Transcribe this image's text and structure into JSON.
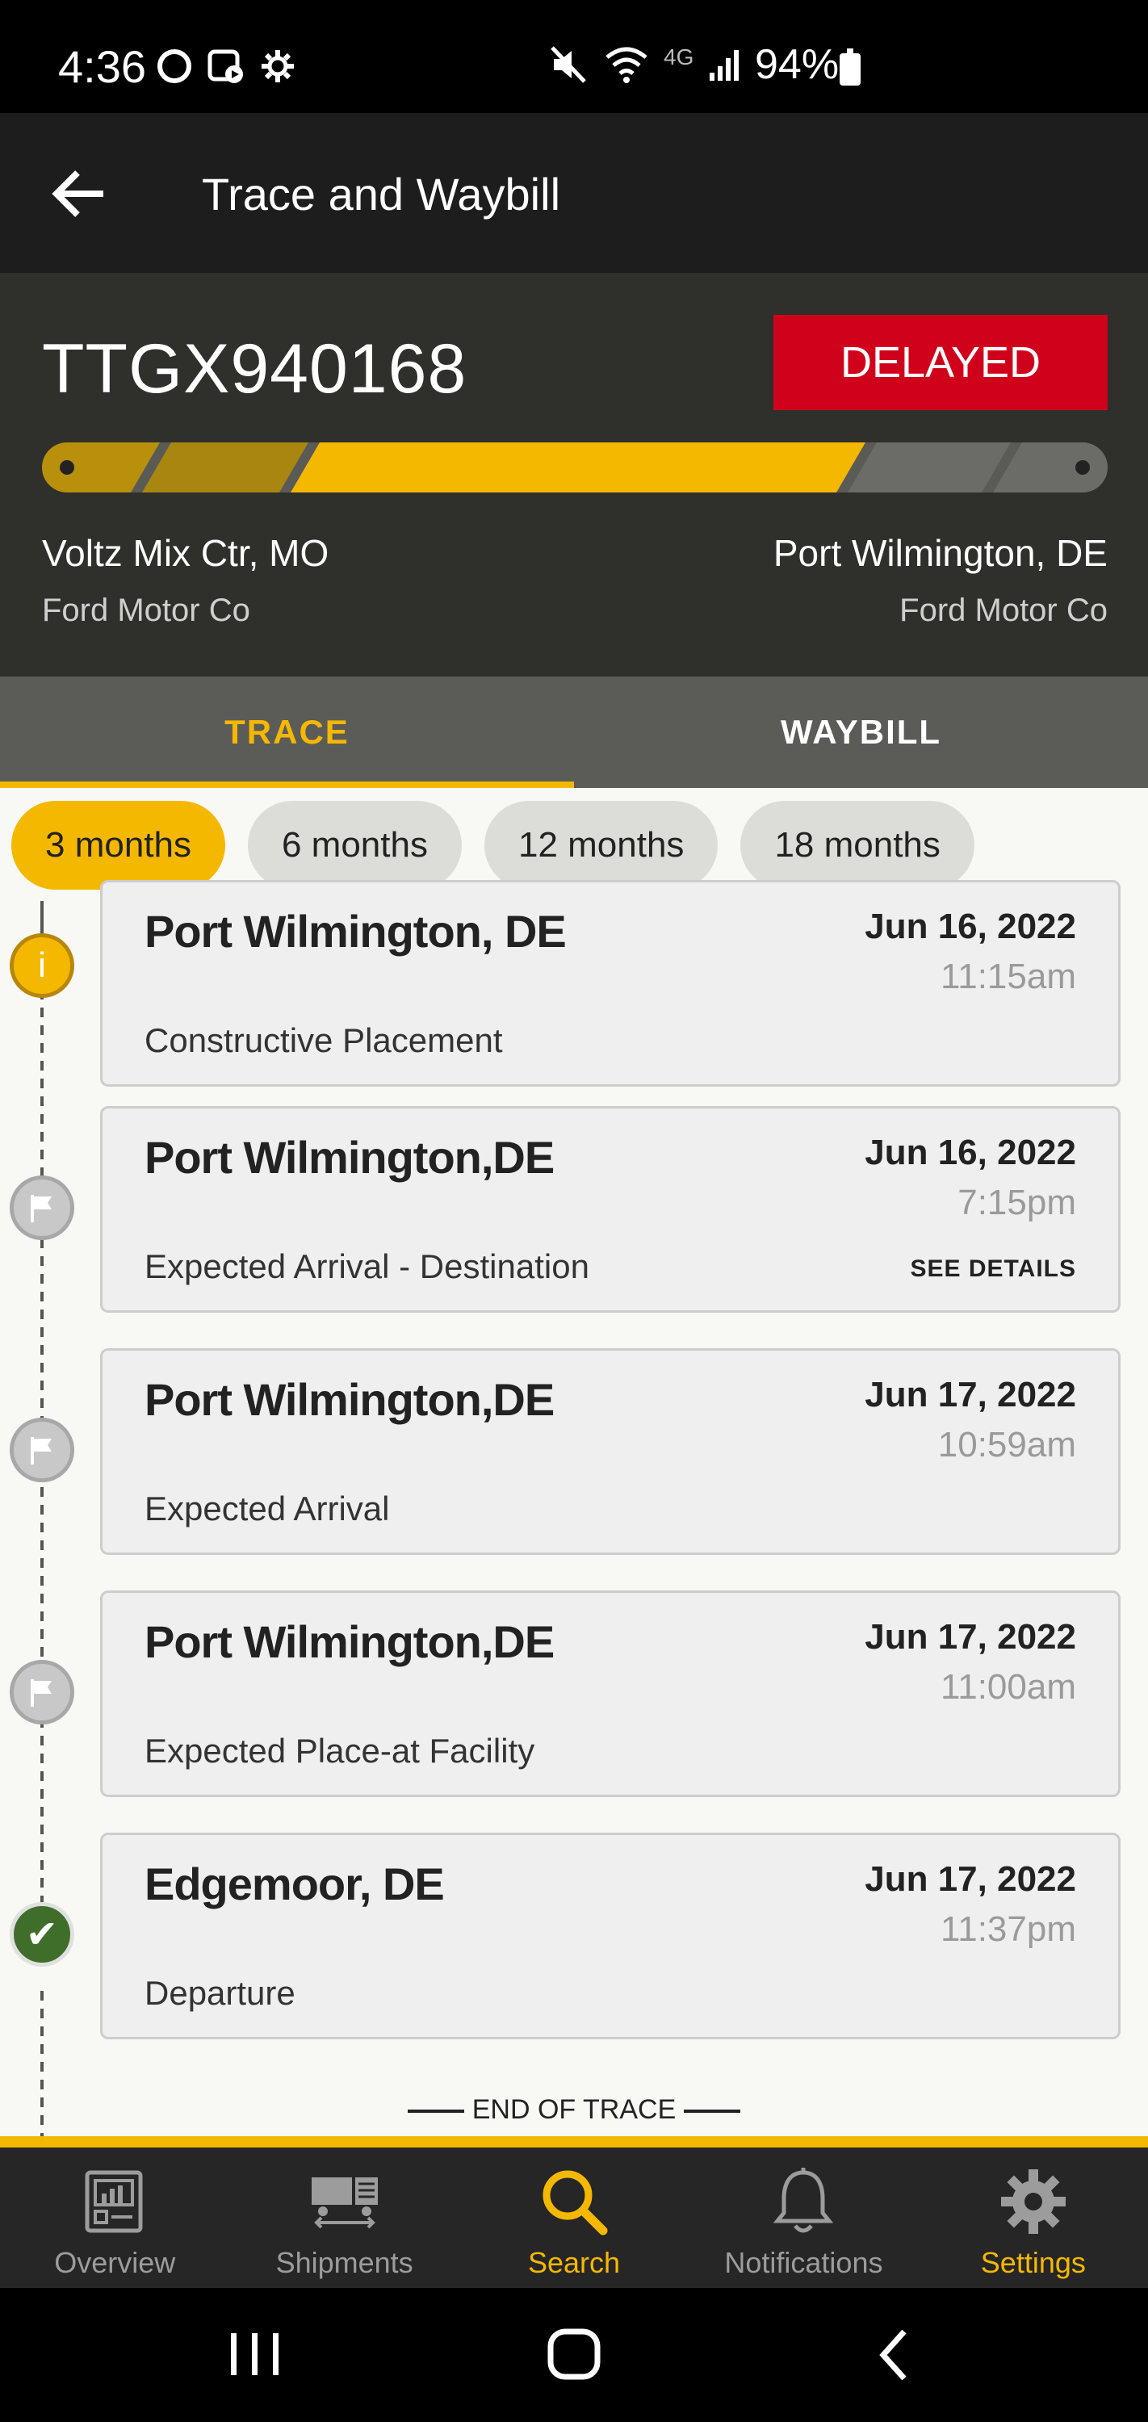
{
  "status_bar": {
    "time": "4:36",
    "network": "4G",
    "battery": "94%"
  },
  "header": {
    "title": "Trace and Waybill"
  },
  "shipment": {
    "car_id": "TTGX940168",
    "status": "DELAYED",
    "origin_city": "Voltz Mix Ctr, MO",
    "origin_company": "Ford Motor Co",
    "destination_city": "Port Wilmington, DE",
    "destination_company": "Ford Motor Co"
  },
  "tabs": [
    {
      "label": "TRACE",
      "active": true
    },
    {
      "label": "WAYBILL",
      "active": false
    }
  ],
  "filters": [
    {
      "label": "3 months",
      "active": true
    },
    {
      "label": "6 months",
      "active": false
    },
    {
      "label": "12 months",
      "active": false
    },
    {
      "label": "18 months",
      "active": false
    }
  ],
  "events": [
    {
      "location": "Port Wilmington, DE",
      "date": "Jun 16, 2022",
      "time": "11:15am",
      "description": "Constructive Placement",
      "marker": "info-icon"
    },
    {
      "location": "Port Wilmington,DE",
      "date": "Jun 16, 2022",
      "time": "7:15pm",
      "description": "Expected Arrival - Destination",
      "details": "SEE DETAILS",
      "marker": "flag-icon"
    },
    {
      "location": "Port Wilmington,DE",
      "date": "Jun 17, 2022",
      "time": "10:59am",
      "description": "Expected Arrival",
      "marker": "flag-icon"
    },
    {
      "location": "Port Wilmington,DE",
      "date": "Jun 17, 2022",
      "time": "11:00am",
      "description": "Expected Place-at Facility",
      "marker": "flag-icon"
    },
    {
      "location": "Edgemoor, DE",
      "date": "Jun 17, 2022",
      "time": "11:37pm",
      "description": "Departure",
      "marker": "check-icon"
    }
  ],
  "end_of_trace": "END OF TRACE",
  "bottom_nav": [
    {
      "label": "Overview",
      "icon": "overview-icon"
    },
    {
      "label": "Shipments",
      "icon": "shipments-icon"
    },
    {
      "label": "Search",
      "icon": "search-icon",
      "active": true
    },
    {
      "label": "Notifications",
      "icon": "bell-icon"
    },
    {
      "label": "Settings",
      "icon": "gear-icon"
    }
  ],
  "colors": {
    "accent": "#f5b800",
    "delayed": "#d0021b",
    "header_bg": "#1d1d1d",
    "summary_bg": "#2f2f2c",
    "tabs_bg": "#5b5b58",
    "done_marker": "#3f6e2a"
  }
}
